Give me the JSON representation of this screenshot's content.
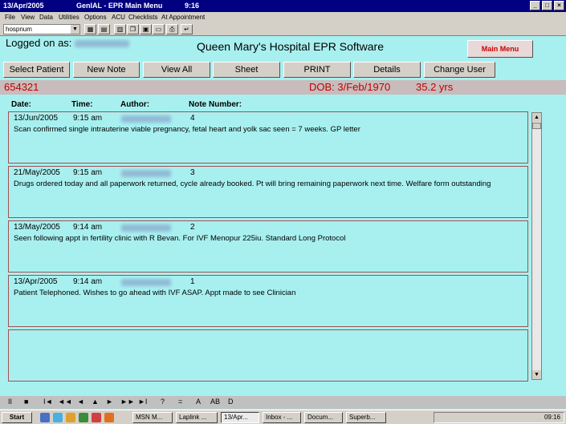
{
  "titlebar": {
    "date": "13/Apr/2005",
    "app": "GenIAL - EPR Main Menu",
    "time": "9:16"
  },
  "window_buttons": [
    "_",
    "□",
    "×"
  ],
  "menu": [
    "File",
    "View",
    "Data",
    "Utilities",
    "Options",
    "ACU",
    "Checklists",
    "At Appointment"
  ],
  "toolbar": {
    "combo_value": "hospnum"
  },
  "header": {
    "logged_on_label": "Logged on as:",
    "app_title": "Queen Mary's Hospital EPR Software",
    "main_menu_button": "Main Menu"
  },
  "nav_buttons": [
    "Select Patient",
    "New Note",
    "View All",
    "Sheet",
    "PRINT",
    "Details",
    "Change User"
  ],
  "patient": {
    "hospnum": "654321",
    "dob": "DOB:  3/Feb/1970",
    "age": "35.2 yrs"
  },
  "columns": {
    "date": "Date:",
    "time": "Time:",
    "author": "Author:",
    "number": "Note Number:"
  },
  "notes": [
    {
      "date": "13/Jun/2005",
      "time": "9:15 am",
      "number": "4",
      "text": "Scan confirmed single intrauterine viable pregnancy, fetal  heart and yolk sac seen = 7 weeks. GP letter"
    },
    {
      "date": "21/May/2005",
      "time": "9:15 am",
      "number": "3",
      "text": "Drugs ordered today and all paperwork returned, cycle already booked. Pt will bring remaining paperwork next time. Welfare form outstanding"
    },
    {
      "date": "13/May/2005",
      "time": "9:14 am",
      "number": "2",
      "text": "Seen following appt in fertility clinic with R Bevan. For IVF Menopur 225iu. Standard Long Protocol"
    },
    {
      "date": "13/Apr/2005",
      "time": "9:14 am",
      "number": "1",
      "text": "Patient Telephoned. Wishes to go ahead with IVF ASAP. Appt made to see Clinician"
    }
  ],
  "record_nav": [
    "II",
    "■",
    "I◄",
    "◄◄",
    "◄",
    "▲",
    "►",
    "►►",
    "►I",
    "?",
    "=",
    "A",
    "AB",
    "D"
  ],
  "taskbar": {
    "start": "Start",
    "tasks": [
      "MSN M...",
      "Laplink ...",
      "13/Apr...",
      "Inbox - ...",
      "Docum...",
      "Superb..."
    ],
    "clock": "09:16"
  },
  "colors": {
    "background": "#a8f0f0",
    "patient_text": "#c00000",
    "title_bar": "#000080"
  }
}
